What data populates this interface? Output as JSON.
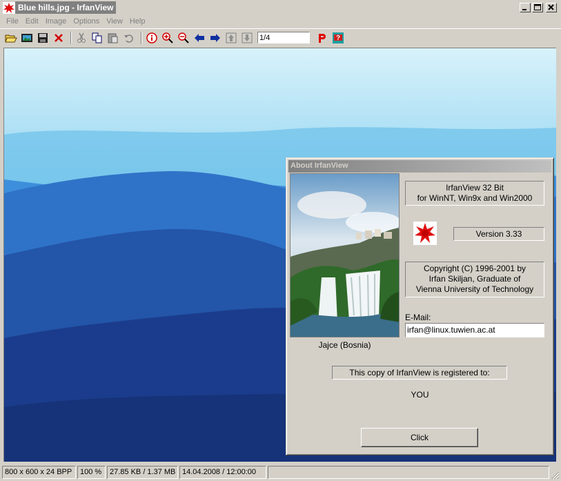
{
  "window": {
    "title": "Blue hills.jpg - IrfanView",
    "minimize_icon": "minimize-icon",
    "maximize_icon": "maximize-icon",
    "close_icon": "close-icon"
  },
  "menu": [
    "File",
    "Edit",
    "Image",
    "Options",
    "View",
    "Help"
  ],
  "toolbar": {
    "icons": [
      "open-folder-icon",
      "slideshow-icon",
      "save-icon",
      "delete-icon",
      "cut-icon",
      "copy-icon",
      "paste-icon",
      "undo-icon",
      "info-icon",
      "zoom-in-icon",
      "zoom-out-icon",
      "previous-icon",
      "next-icon",
      "first-file-icon",
      "last-file-icon",
      "print-icon",
      "help-icon"
    ],
    "page_value": "1/4"
  },
  "colors": {
    "sky": "#cfeef8",
    "hills_dark": "#1b3c8c",
    "hills_light": "#3d8fdb",
    "logo_red": "#e01010"
  },
  "status": {
    "dimensions": "800 x 600 x 24 BPP",
    "zoom": "100 %",
    "size": "27.85 KB / 1.37 MB",
    "date": "14.04.2008 / 12:00:00"
  },
  "about": {
    "title": "About  IrfanView",
    "app_line1": "IrfanView 32 Bit",
    "app_line2": "for WinNT, Win9x and Win2000",
    "version": "Version 3.33",
    "copyright1": "Copyright (C) 1996-2001 by",
    "copyright2": "Irfan Skiljan, Graduate of",
    "copyright3": "Vienna University of Technology",
    "email_label": "E-Mail:",
    "email": "irfan@linux.tuwien.ac.at",
    "photo_caption": "Jajce (Bosnia)",
    "registered_text": "This copy of IrfanView is registered to:",
    "registered_name": "YOU",
    "button": "Click"
  }
}
